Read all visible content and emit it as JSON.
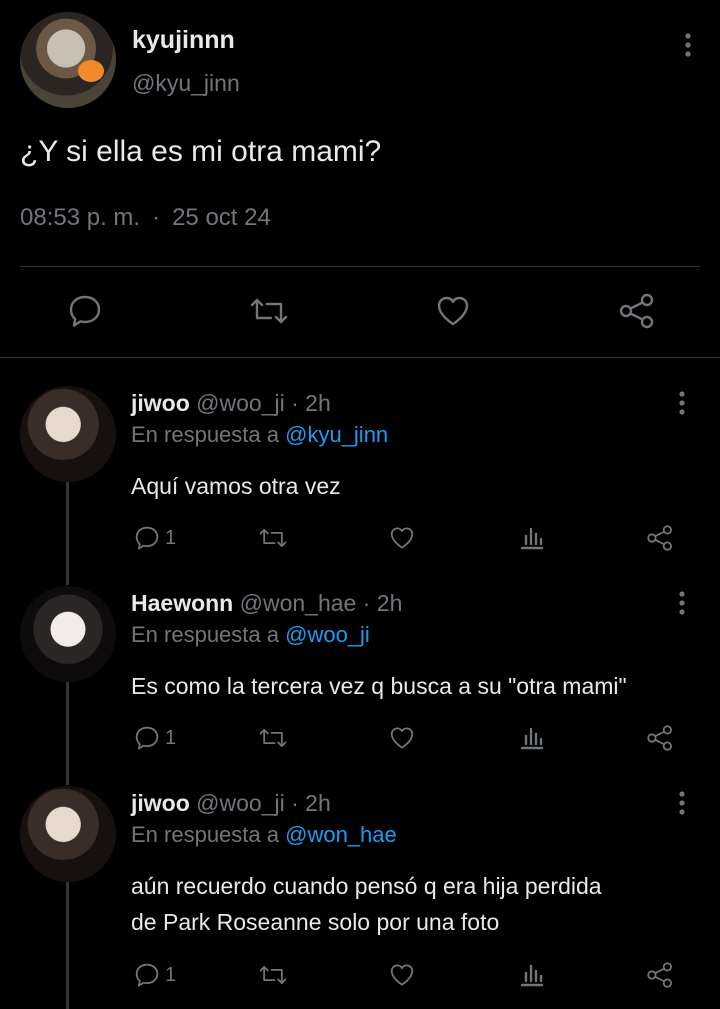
{
  "main_tweet": {
    "display_name": "kyujinnn",
    "handle": "@kyu_jinn",
    "text": "¿Y si ella es mi otra mami?",
    "time": "08:53 p. m.",
    "separator": "·",
    "date": "25 oct 24"
  },
  "replies": [
    {
      "display_name": "jiwoo",
      "handle": "@woo_ji",
      "age": "· 2h",
      "reply_prefix": "En respuesta a",
      "reply_to": "@kyu_jinn",
      "text_lines": [
        "Aquí vamos otra vez"
      ],
      "reply_count": "1"
    },
    {
      "display_name": "Haewonn",
      "handle": "@won_hae",
      "age": "· 2h",
      "reply_prefix": "En respuesta a",
      "reply_to": "@woo_ji",
      "text_lines": [
        "Es como la tercera vez q busca a su \"otra mami\""
      ],
      "reply_count": "1"
    },
    {
      "display_name": "jiwoo",
      "handle": "@woo_ji",
      "age": "· 2h",
      "reply_prefix": "En respuesta a",
      "reply_to": "@won_hae",
      "text_lines": [
        "aún recuerdo cuando pensó q era hija perdida",
        "de Park Roseanne solo por una foto"
      ],
      "reply_count": "1"
    }
  ],
  "icons": [
    "reply-icon",
    "retweet-icon",
    "like-icon",
    "views-icon",
    "share-icon",
    "more-icon"
  ],
  "colors": {
    "background": "#000000",
    "text": "#e7e9ea",
    "muted": "#71767b",
    "link": "#1d9bf0",
    "divider": "#2f3336"
  }
}
